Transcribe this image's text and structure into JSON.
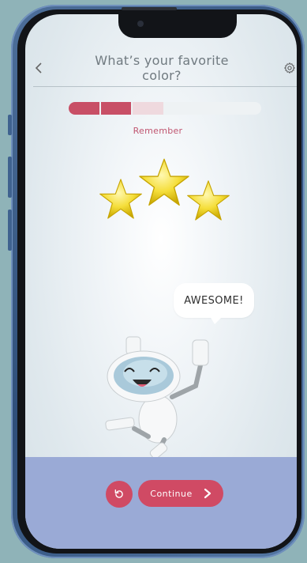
{
  "header": {
    "title_line1": "What’s your favorite",
    "title_line2": "color?",
    "back_icon": "chevron-left-icon",
    "settings_icon": "gear-icon"
  },
  "progress": {
    "segments_done": 2,
    "segments_partial": 1,
    "segments_total": 6,
    "label": "Remember"
  },
  "reward": {
    "stars": 3,
    "star_icon": "star-icon"
  },
  "mascot": {
    "speech": "AWESOME!"
  },
  "footer": {
    "undo_icon": "undo-icon",
    "continue_label": "Continue",
    "continue_icon": "chevron-right-icon"
  },
  "colors": {
    "accent": "#d04a64",
    "footer_bg": "#9aaad6",
    "progress_done": "#c84f66",
    "star": "#f5de3a"
  }
}
